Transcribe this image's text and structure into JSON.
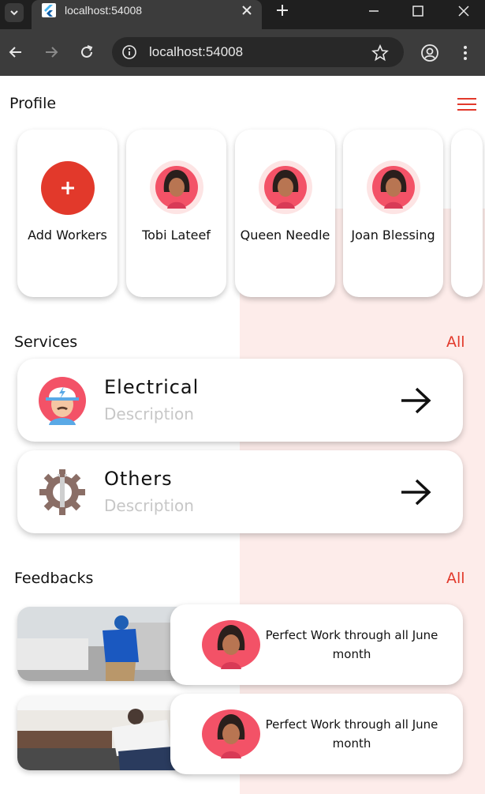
{
  "browser": {
    "tab_title": "localhost:54008",
    "address": "localhost:54008"
  },
  "header": {
    "title": "Profile"
  },
  "workers": {
    "add_label": "Add Workers",
    "items": [
      {
        "name": "Tobi Lateef"
      },
      {
        "name": "Queen Needle"
      },
      {
        "name": "Joan Blessing"
      }
    ]
  },
  "services": {
    "title": "Services",
    "all_label": "All",
    "items": [
      {
        "name": "Electrical",
        "description": "Description"
      },
      {
        "name": "Others",
        "description": "Description"
      }
    ]
  },
  "feedbacks": {
    "title": "Feedbacks",
    "all_label": "All",
    "items": [
      {
        "text": "Perfect Work through all June month"
      },
      {
        "text": "Perfect Work through all June month"
      }
    ]
  },
  "colors": {
    "accent": "#e2392b",
    "pink_background": "#fdecea",
    "chrome_dark": "#1f1f1f",
    "chrome_toolbar": "#3c3c3c"
  },
  "icons": [
    "chevron-down-icon",
    "flutter-icon",
    "close-icon",
    "plus-icon",
    "minimize-icon",
    "maximize-icon",
    "back-arrow-icon",
    "forward-arrow-icon",
    "reload-icon",
    "info-icon",
    "star-icon",
    "profile-icon",
    "kebab-menu-icon",
    "hamburger-menu-icon",
    "arrow-right-icon",
    "electrician-icon",
    "gear-wrench-icon",
    "avatar-icon"
  ]
}
